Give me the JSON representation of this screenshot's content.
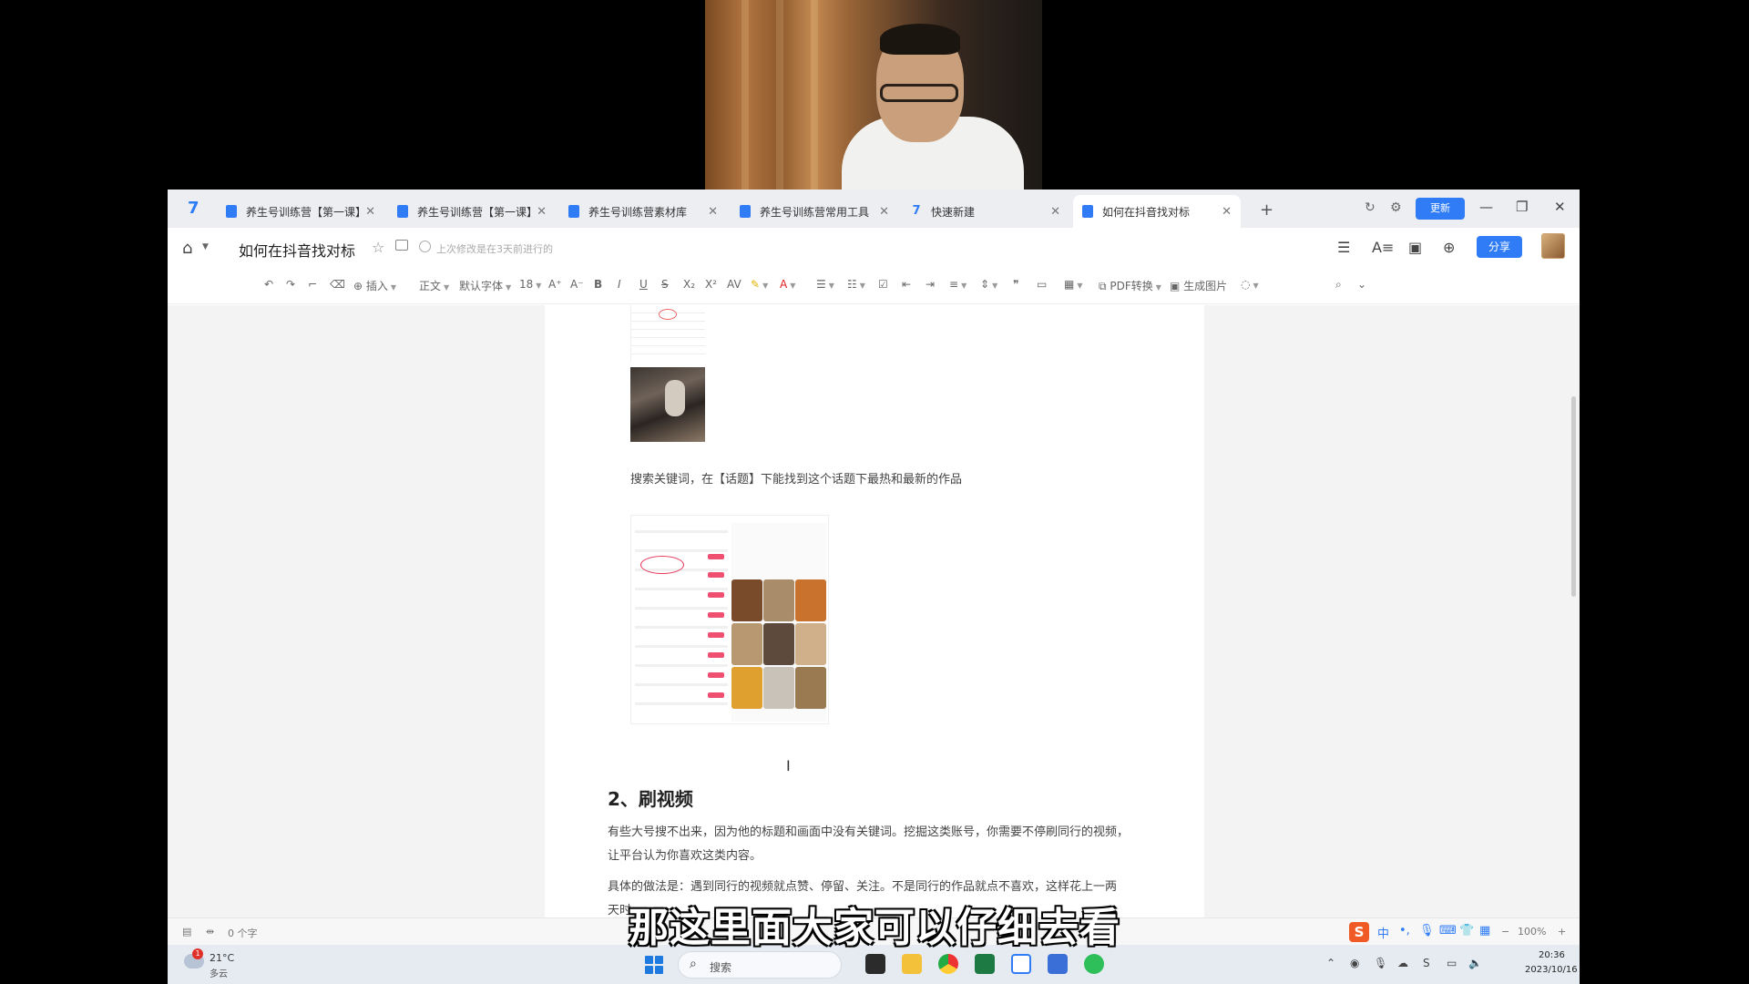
{
  "tabs": [
    {
      "label": "养生号训练营【第一课】..."
    },
    {
      "label": "养生号训练营【第一课】..."
    },
    {
      "label": "养生号训练营素材库"
    },
    {
      "label": "养生号训练营常用工具"
    },
    {
      "label": "快速新建"
    },
    {
      "label": "如何在抖音找对标"
    }
  ],
  "window": {
    "update_label": "更新"
  },
  "titlebar": {
    "doc_title": "如何在抖音找对标",
    "save_status": "上次修改是在3天前进行的",
    "share_label": "分享"
  },
  "toolbar": {
    "insert": "插入",
    "style": "正文",
    "font": "默认字体",
    "size": "18",
    "pdf": "PDF转换",
    "gen_image": "生成图片"
  },
  "content": {
    "caption": "搜索关键词，在【话题】下能找到这个话题下最热和最新的作品",
    "heading": "2、刷视频",
    "para1_line1": "有些大号搜不出来，因为他的标题和画面中没有关键词。挖掘这类账号，你需要不停刷同行的视频，",
    "para1_line2": "让平台认为你喜欢这类内容。",
    "para2_line1": "具体的做法是：遇到同行的视频就点赞、停留、关注。不是同行的作品就点不喜欢，这样花上一两",
    "para2_line2": "天时"
  },
  "statusbar": {
    "word_count": "0 个字",
    "ime_lang": "中",
    "zoom": "100%"
  },
  "taskbar": {
    "weather_badge": "1",
    "temperature": "21°C",
    "condition": "多云",
    "search_placeholder": "搜索",
    "time": "20:36",
    "date": "2023/10/16"
  },
  "subtitle": "那这里面大家可以仔细去看",
  "colors": {
    "accent": "#2f7cf6",
    "highlight": "#e6385c"
  }
}
